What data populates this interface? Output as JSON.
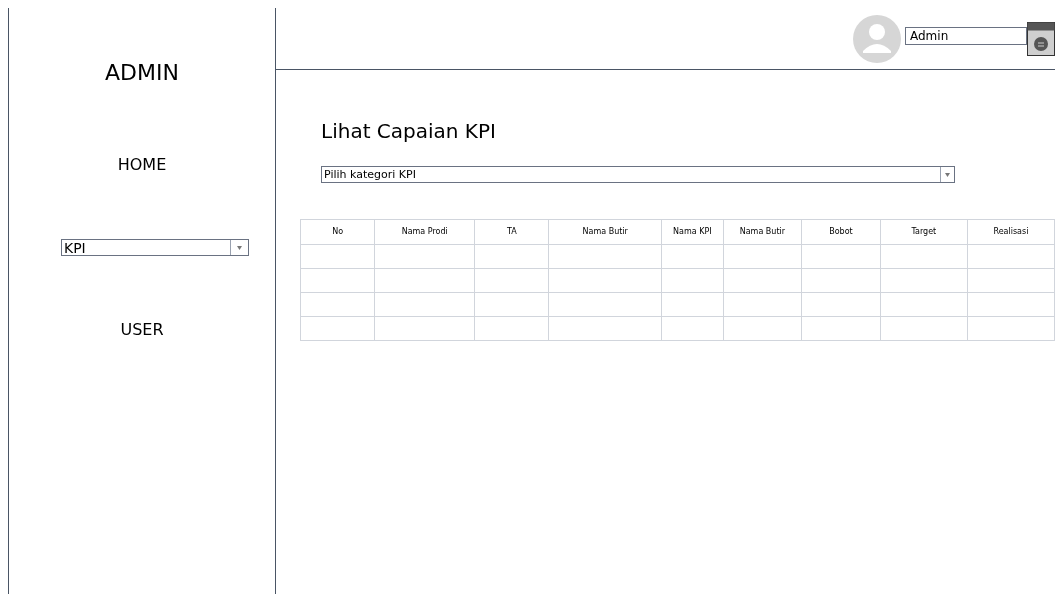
{
  "sidebar": {
    "title": "ADMIN",
    "items": [
      {
        "kind": "link",
        "label": "HOME"
      },
      {
        "kind": "dropdown",
        "label": "KPI"
      },
      {
        "kind": "link",
        "label": "USER"
      }
    ]
  },
  "header": {
    "user": "Admin"
  },
  "page": {
    "title": "Lihat Capaian KPI",
    "category_select": {
      "placeholder": "Pilih kategori KPI"
    }
  },
  "table": {
    "columns": [
      "No",
      "Nama Prodi",
      "TA",
      "Nama Butir",
      "Nama KPI",
      "Nama Butir",
      "Bobot",
      "Target",
      "Realisasi"
    ]
  }
}
